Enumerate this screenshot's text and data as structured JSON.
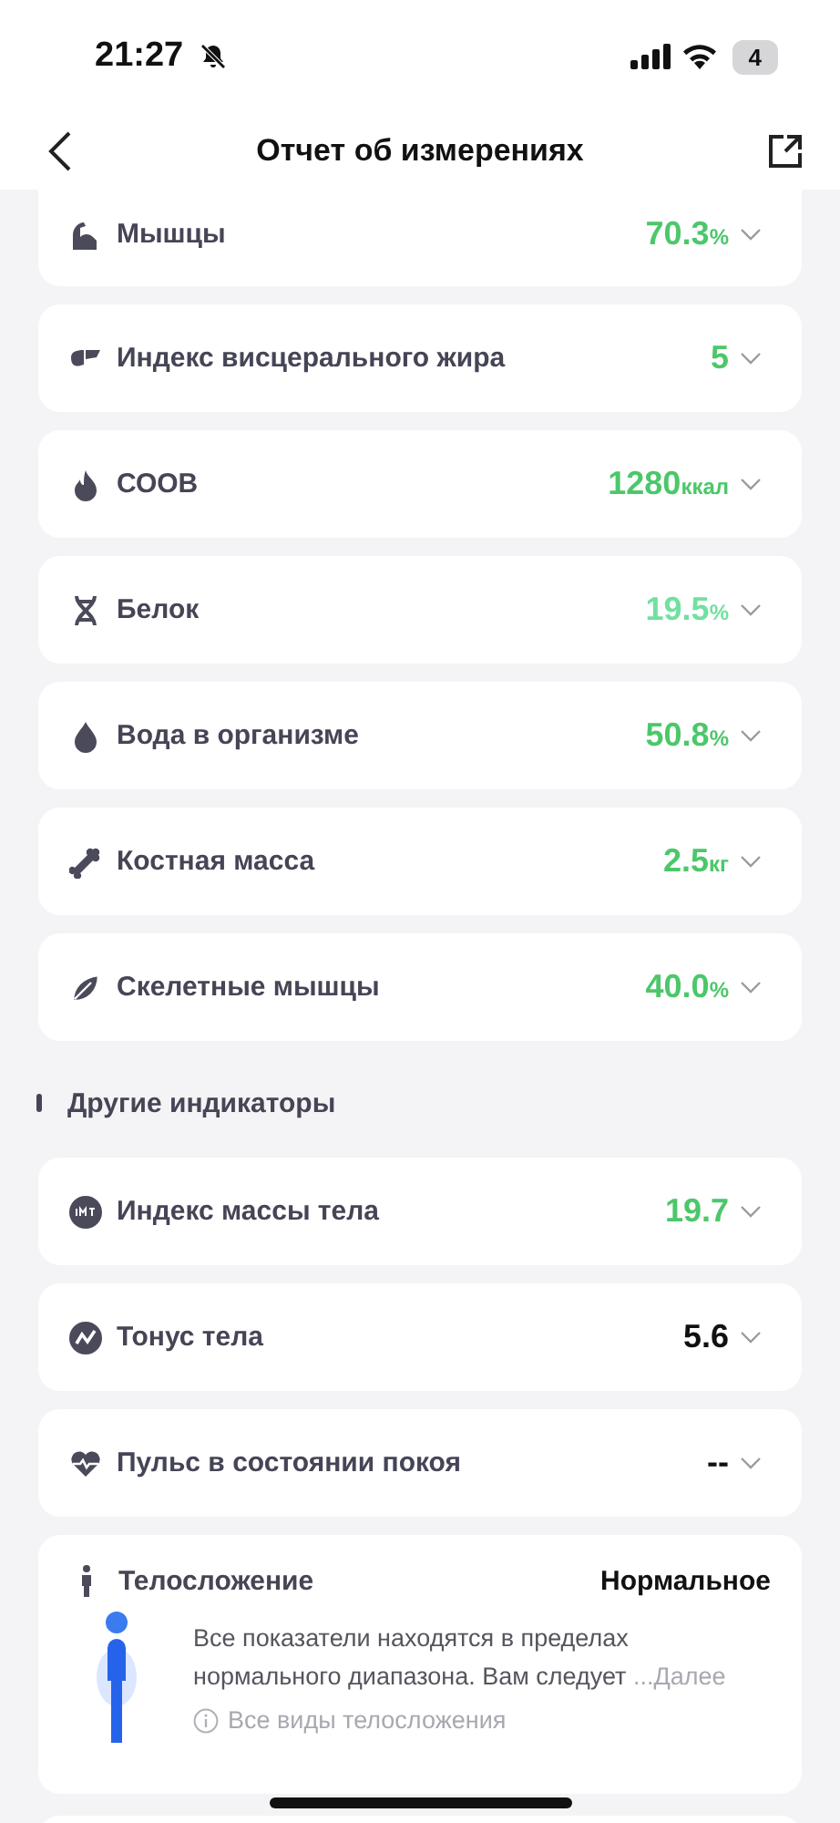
{
  "status_bar": {
    "time": "21:27",
    "battery": "4"
  },
  "nav": {
    "title": "Отчет об измерениях"
  },
  "metrics": [
    {
      "name": "Мышцы",
      "value": "70.3",
      "unit": "%",
      "color": "#4cc76a"
    },
    {
      "name": "Индекс висцерального жира",
      "value": "5",
      "color": "#4cc76a"
    },
    {
      "name": "СООВ",
      "value": "1280",
      "unit": "ккал",
      "color": "#4cc76a"
    },
    {
      "name": "Белок",
      "value": "19.5",
      "unit": "%",
      "color": "#72e0a0"
    },
    {
      "name": "Вода в организме",
      "value": "50.8",
      "unit": "%",
      "color": "#4cc76a"
    },
    {
      "name": "Костная масса",
      "value": "2.5",
      "unit": "кг",
      "color": "#4cc76a"
    },
    {
      "name": "Скелетные мышцы",
      "value": "40.0",
      "unit": "%",
      "color": "#4cc76a"
    }
  ],
  "other_section": {
    "title": "Другие индикаторы",
    "metrics": [
      {
        "name": "Индекс массы тела",
        "value": "19.7",
        "color": "#4cc76a"
      },
      {
        "name": "Тонус тела",
        "value": "5.6",
        "color": "#111111"
      },
      {
        "name": "Пульс в состоянии покоя",
        "value": "--",
        "color": "#111111"
      }
    ]
  },
  "body_type": {
    "title": "Телосложение",
    "result": "Нормальное",
    "text": "Все показатели находятся в пределах нормального диапазона. Вам следует",
    "more": "...Далее",
    "link": "Все виды телосложения"
  }
}
